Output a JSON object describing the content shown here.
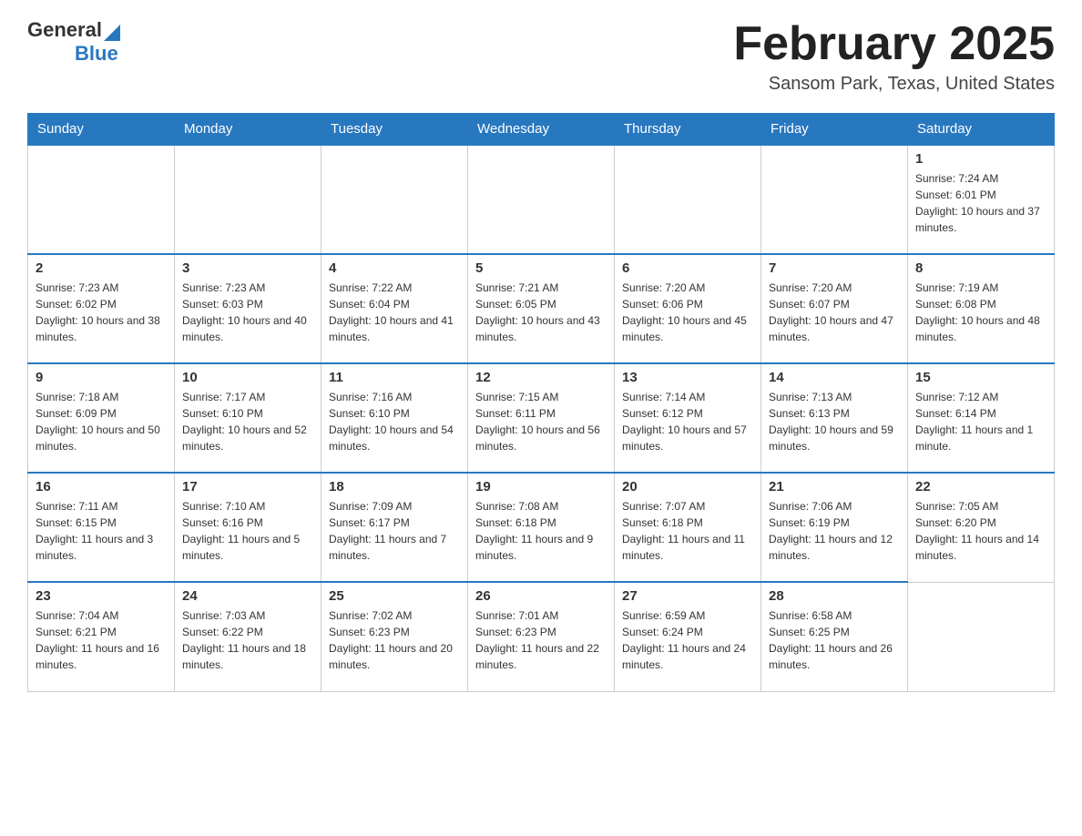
{
  "header": {
    "logo_general": "General",
    "logo_blue": "Blue",
    "month": "February 2025",
    "location": "Sansom Park, Texas, United States"
  },
  "weekdays": [
    "Sunday",
    "Monday",
    "Tuesday",
    "Wednesday",
    "Thursday",
    "Friday",
    "Saturday"
  ],
  "weeks": [
    [
      {
        "day": "",
        "sunrise": "",
        "sunset": "",
        "daylight": ""
      },
      {
        "day": "",
        "sunrise": "",
        "sunset": "",
        "daylight": ""
      },
      {
        "day": "",
        "sunrise": "",
        "sunset": "",
        "daylight": ""
      },
      {
        "day": "",
        "sunrise": "",
        "sunset": "",
        "daylight": ""
      },
      {
        "day": "",
        "sunrise": "",
        "sunset": "",
        "daylight": ""
      },
      {
        "day": "",
        "sunrise": "",
        "sunset": "",
        "daylight": ""
      },
      {
        "day": "1",
        "sunrise": "Sunrise: 7:24 AM",
        "sunset": "Sunset: 6:01 PM",
        "daylight": "Daylight: 10 hours and 37 minutes."
      }
    ],
    [
      {
        "day": "2",
        "sunrise": "Sunrise: 7:23 AM",
        "sunset": "Sunset: 6:02 PM",
        "daylight": "Daylight: 10 hours and 38 minutes."
      },
      {
        "day": "3",
        "sunrise": "Sunrise: 7:23 AM",
        "sunset": "Sunset: 6:03 PM",
        "daylight": "Daylight: 10 hours and 40 minutes."
      },
      {
        "day": "4",
        "sunrise": "Sunrise: 7:22 AM",
        "sunset": "Sunset: 6:04 PM",
        "daylight": "Daylight: 10 hours and 41 minutes."
      },
      {
        "day": "5",
        "sunrise": "Sunrise: 7:21 AM",
        "sunset": "Sunset: 6:05 PM",
        "daylight": "Daylight: 10 hours and 43 minutes."
      },
      {
        "day": "6",
        "sunrise": "Sunrise: 7:20 AM",
        "sunset": "Sunset: 6:06 PM",
        "daylight": "Daylight: 10 hours and 45 minutes."
      },
      {
        "day": "7",
        "sunrise": "Sunrise: 7:20 AM",
        "sunset": "Sunset: 6:07 PM",
        "daylight": "Daylight: 10 hours and 47 minutes."
      },
      {
        "day": "8",
        "sunrise": "Sunrise: 7:19 AM",
        "sunset": "Sunset: 6:08 PM",
        "daylight": "Daylight: 10 hours and 48 minutes."
      }
    ],
    [
      {
        "day": "9",
        "sunrise": "Sunrise: 7:18 AM",
        "sunset": "Sunset: 6:09 PM",
        "daylight": "Daylight: 10 hours and 50 minutes."
      },
      {
        "day": "10",
        "sunrise": "Sunrise: 7:17 AM",
        "sunset": "Sunset: 6:10 PM",
        "daylight": "Daylight: 10 hours and 52 minutes."
      },
      {
        "day": "11",
        "sunrise": "Sunrise: 7:16 AM",
        "sunset": "Sunset: 6:10 PM",
        "daylight": "Daylight: 10 hours and 54 minutes."
      },
      {
        "day": "12",
        "sunrise": "Sunrise: 7:15 AM",
        "sunset": "Sunset: 6:11 PM",
        "daylight": "Daylight: 10 hours and 56 minutes."
      },
      {
        "day": "13",
        "sunrise": "Sunrise: 7:14 AM",
        "sunset": "Sunset: 6:12 PM",
        "daylight": "Daylight: 10 hours and 57 minutes."
      },
      {
        "day": "14",
        "sunrise": "Sunrise: 7:13 AM",
        "sunset": "Sunset: 6:13 PM",
        "daylight": "Daylight: 10 hours and 59 minutes."
      },
      {
        "day": "15",
        "sunrise": "Sunrise: 7:12 AM",
        "sunset": "Sunset: 6:14 PM",
        "daylight": "Daylight: 11 hours and 1 minute."
      }
    ],
    [
      {
        "day": "16",
        "sunrise": "Sunrise: 7:11 AM",
        "sunset": "Sunset: 6:15 PM",
        "daylight": "Daylight: 11 hours and 3 minutes."
      },
      {
        "day": "17",
        "sunrise": "Sunrise: 7:10 AM",
        "sunset": "Sunset: 6:16 PM",
        "daylight": "Daylight: 11 hours and 5 minutes."
      },
      {
        "day": "18",
        "sunrise": "Sunrise: 7:09 AM",
        "sunset": "Sunset: 6:17 PM",
        "daylight": "Daylight: 11 hours and 7 minutes."
      },
      {
        "day": "19",
        "sunrise": "Sunrise: 7:08 AM",
        "sunset": "Sunset: 6:18 PM",
        "daylight": "Daylight: 11 hours and 9 minutes."
      },
      {
        "day": "20",
        "sunrise": "Sunrise: 7:07 AM",
        "sunset": "Sunset: 6:18 PM",
        "daylight": "Daylight: 11 hours and 11 minutes."
      },
      {
        "day": "21",
        "sunrise": "Sunrise: 7:06 AM",
        "sunset": "Sunset: 6:19 PM",
        "daylight": "Daylight: 11 hours and 12 minutes."
      },
      {
        "day": "22",
        "sunrise": "Sunrise: 7:05 AM",
        "sunset": "Sunset: 6:20 PM",
        "daylight": "Daylight: 11 hours and 14 minutes."
      }
    ],
    [
      {
        "day": "23",
        "sunrise": "Sunrise: 7:04 AM",
        "sunset": "Sunset: 6:21 PM",
        "daylight": "Daylight: 11 hours and 16 minutes."
      },
      {
        "day": "24",
        "sunrise": "Sunrise: 7:03 AM",
        "sunset": "Sunset: 6:22 PM",
        "daylight": "Daylight: 11 hours and 18 minutes."
      },
      {
        "day": "25",
        "sunrise": "Sunrise: 7:02 AM",
        "sunset": "Sunset: 6:23 PM",
        "daylight": "Daylight: 11 hours and 20 minutes."
      },
      {
        "day": "26",
        "sunrise": "Sunrise: 7:01 AM",
        "sunset": "Sunset: 6:23 PM",
        "daylight": "Daylight: 11 hours and 22 minutes."
      },
      {
        "day": "27",
        "sunrise": "Sunrise: 6:59 AM",
        "sunset": "Sunset: 6:24 PM",
        "daylight": "Daylight: 11 hours and 24 minutes."
      },
      {
        "day": "28",
        "sunrise": "Sunrise: 6:58 AM",
        "sunset": "Sunset: 6:25 PM",
        "daylight": "Daylight: 11 hours and 26 minutes."
      },
      {
        "day": "",
        "sunrise": "",
        "sunset": "",
        "daylight": ""
      }
    ]
  ]
}
